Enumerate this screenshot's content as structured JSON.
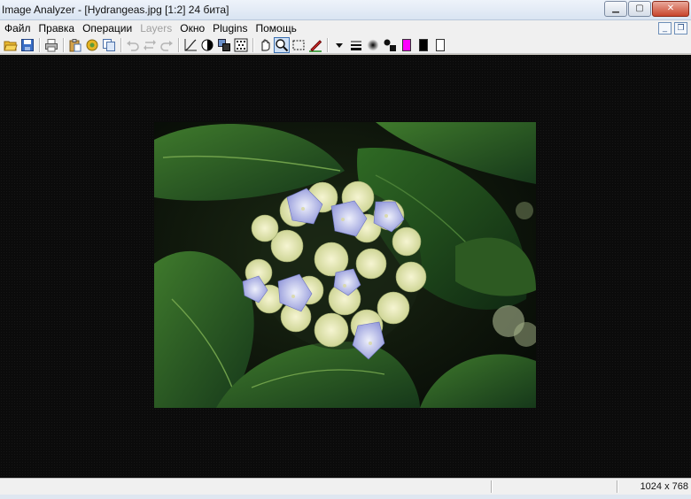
{
  "window": {
    "title": "Image Analyzer - [Hydrangeas.jpg [1:2] 24 бита]",
    "controls": [
      "minimize",
      "maximize",
      "close"
    ]
  },
  "menu": {
    "items": [
      {
        "label": "Файл",
        "enabled": true
      },
      {
        "label": "Правка",
        "enabled": true
      },
      {
        "label": "Операции",
        "enabled": true
      },
      {
        "label": "Layers",
        "enabled": false
      },
      {
        "label": "Окно",
        "enabled": true
      },
      {
        "label": "Plugins",
        "enabled": true
      },
      {
        "label": "Помощь",
        "enabled": true
      }
    ]
  },
  "toolbar": {
    "buttons": [
      "open-icon",
      "save-icon",
      "print-icon",
      "paste-icon",
      "settings-icon",
      "copy-icon",
      "undo-icon",
      "redo-icon-alt",
      "redo-icon",
      "curves-icon",
      "contrast-icon",
      "channels-icon",
      "histogram-icon",
      "hand-icon",
      "zoom-icon",
      "select-icon",
      "pen-icon",
      "dropdown-icon",
      "line-width-icon",
      "brush-icon",
      "shapes-icon",
      "primary-color-icon",
      "secondary-color-icon",
      "white-color-icon"
    ],
    "active_tool": "zoom-icon",
    "colors": {
      "magenta": "#ff00ff",
      "black": "#000000",
      "white": "#ffffff"
    }
  },
  "document": {
    "file": "Hydrangeas.jpg",
    "zoom": "1:2",
    "bit_depth": "24 бита"
  },
  "status": {
    "image_size": "1024 x 768"
  },
  "colors": {
    "canvas_bg": "#0b0b0b",
    "titlebar": "#dbe5f2",
    "chrome": "#f0f0f0"
  }
}
